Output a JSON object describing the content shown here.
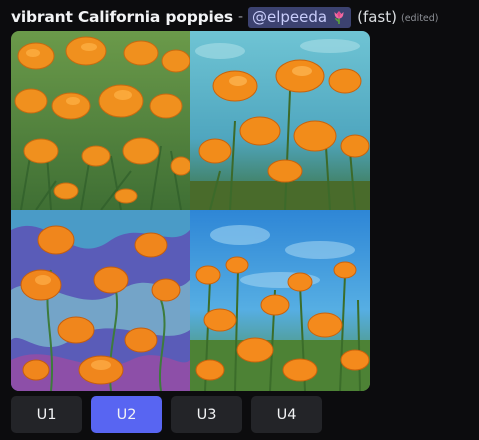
{
  "message": {
    "prompt": "vibrant California poppies",
    "separator": "-",
    "mention": "@elpeeda",
    "mention_icon": "tulip-emoji",
    "mode": "(fast)",
    "edited": "(edited)"
  },
  "image_grid": {
    "tiles": [
      {
        "name": "image-tile-1",
        "style": "dense orange poppies on green stems"
      },
      {
        "name": "image-tile-2",
        "style": "poppies against teal sky"
      },
      {
        "name": "image-tile-3",
        "style": "poppies on swirling blue-purple background"
      },
      {
        "name": "image-tile-4",
        "style": "poppies in field under blue sky"
      }
    ]
  },
  "buttons": [
    {
      "label": "U1",
      "active": false
    },
    {
      "label": "U2",
      "active": true
    },
    {
      "label": "U3",
      "active": false
    },
    {
      "label": "U4",
      "active": false
    }
  ],
  "colors": {
    "background": "#0c0c0e",
    "mention_bg": "#3c4270",
    "button_bg": "#232428",
    "button_active": "#5865f2",
    "poppy_orange": "#f08a1c"
  }
}
